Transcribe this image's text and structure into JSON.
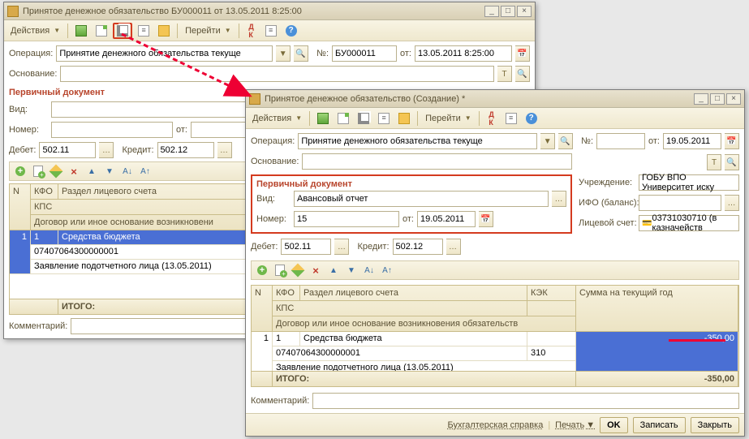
{
  "win1": {
    "title": "Принятое денежное обязательство БУ000011 от 13.05.2011 8:25:00",
    "toolbar": {
      "actions": "Действия",
      "goto": "Перейти"
    },
    "labels": {
      "operation": "Операция:",
      "no": "№:",
      "ot": "от:",
      "basis": "Основание:",
      "primary": "Первичный документ",
      "vid": "Вид:",
      "nomer": "Номер:",
      "debet": "Дебет:",
      "kredit": "Кредит:",
      "comment": "Комментарий:",
      "itogo": "ИТОГО:"
    },
    "operation_val": "Принятие денежного обязательства текуще",
    "doc_no": "БУ000011",
    "doc_date": "13.05.2011  8:25:00",
    "basis_val": "",
    "vid_val": "",
    "nomer_val": "",
    "nomer_date": "",
    "debet": "502.11",
    "kredit": "502.12",
    "grid": {
      "h_n": "N",
      "h_kfo": "КФО",
      "h_razdel": "Раздел лицевого счета",
      "h_kps": "КПС",
      "h_dog": "Договор или иное основание возникновени",
      "r_n": "1",
      "r_kfo": "1",
      "r_razdel": "Средства бюджета",
      "r_kps": "07407064300000001",
      "r_dog": "Заявление подотчетного лица (13.05.2011)"
    },
    "comment_val": ""
  },
  "win2": {
    "title": "Принятое денежное обязательство (Создание) *",
    "toolbar": {
      "actions": "Действия",
      "goto": "Перейти"
    },
    "labels": {
      "operation": "Операция:",
      "no": "№:",
      "ot": "от:",
      "basis": "Основание:",
      "primary": "Первичный документ",
      "vid": "Вид:",
      "nomer": "Номер:",
      "debet": "Дебет:",
      "kredit": "Кредит:",
      "uchr": "Учреждение:",
      "ifo": "ИФО (баланс):",
      "lits": "Лицевой счет:",
      "comment": "Комментарий:",
      "itogo": "ИТОГО:"
    },
    "operation_val": "Принятие денежного обязательства текуще",
    "doc_no": "",
    "doc_date": "19.05.2011",
    "basis_val": "",
    "vid_val": "Авансовый отчет",
    "nomer_val": "15",
    "nomer_date": "19.05.2011",
    "debet": "502.11",
    "kredit": "502.12",
    "uchr_val": "ГОБУ ВПО Университет иску",
    "ifo_val": "",
    "lits_val": "03731030710 (в казначейств",
    "grid": {
      "h_n": "N",
      "h_kfo": "КФО",
      "h_razdel": "Раздел лицевого счета",
      "h_kps": "КПС",
      "h_kek": "КЭК",
      "h_sum": "Сумма на текущий год",
      "h_dog": "Договор или иное основание возникновения обязательств",
      "r_n": "1",
      "r_kfo": "1",
      "r_razdel": "Средства бюджета",
      "r_kps": "07407064300000001",
      "r_kek": "310",
      "r_sum": "-350,00",
      "r_dog": "Заявление подотчетного лица (13.05.2011)",
      "f_sum": "-350,00"
    },
    "comment_val": "",
    "footer": {
      "spravka": "Бухгалтерская справка",
      "print": "Печать",
      "ok": "OK",
      "save": "Записать",
      "close": "Закрыть"
    }
  }
}
